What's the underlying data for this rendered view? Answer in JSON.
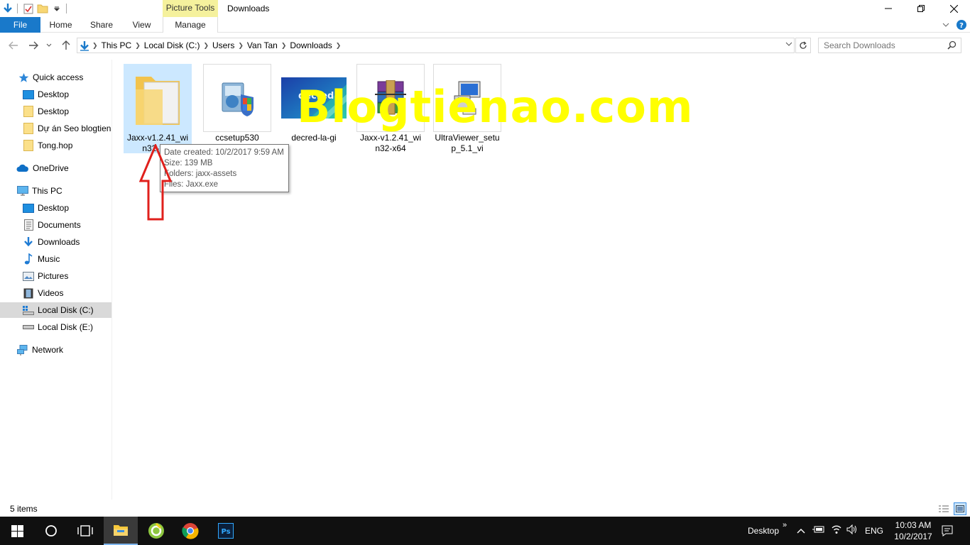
{
  "titlebar": {
    "window_title": "Downloads",
    "context_tab": "Picture Tools"
  },
  "ribbon": {
    "tabs": [
      "File",
      "Home",
      "Share",
      "View",
      "Manage"
    ]
  },
  "address": {
    "crumbs": [
      "This PC",
      "Local Disk (C:)",
      "Users",
      "Van Tan",
      "Downloads"
    ]
  },
  "search": {
    "placeholder": "Search Downloads"
  },
  "nav": {
    "quick_access": "Quick access",
    "qa_items": [
      "Desktop",
      "Desktop",
      "Dự án Seo blogtienao",
      "Tong.hop"
    ],
    "onedrive": "OneDrive",
    "this_pc": "This PC",
    "pc_items": [
      "Desktop",
      "Documents",
      "Downloads",
      "Music",
      "Pictures",
      "Videos",
      "Local Disk (C:)",
      "Local Disk (E:)"
    ],
    "network": "Network"
  },
  "files": [
    {
      "name": "Jaxx-v1.2.41_win32-x64",
      "icon": "folder-icon"
    },
    {
      "name": "ccsetup530",
      "icon": "installer-icon"
    },
    {
      "name": "decred-la-gi",
      "icon": "image-thumbnail"
    },
    {
      "name": "Jaxx-v1.2.41_win32-x64",
      "icon": "winrar-archive-icon"
    },
    {
      "name": "UltraViewer_setup_5.1_vi",
      "icon": "setup-computer-icon"
    }
  ],
  "tooltip": {
    "date_created": "Date created: 10/2/2017 9:59 AM",
    "size": "Size: 139 MB",
    "folders": "Folders: jaxx-assets",
    "files": "Files: Jaxx.exe"
  },
  "watermark": "Blogtienao.com",
  "thumbnail_text": "decred",
  "status": {
    "items": "5 items"
  },
  "taskbar": {
    "desktop_label": "Desktop",
    "language": "ENG",
    "time": "10:03 AM",
    "date": "10/2/2017"
  },
  "colors": {
    "accent": "#1979ca",
    "context_tab": "#f5f19d",
    "selection": "#cce8ff",
    "watermark": "#ffff00",
    "arrow": "#e0201c",
    "taskbar": "#101010"
  }
}
